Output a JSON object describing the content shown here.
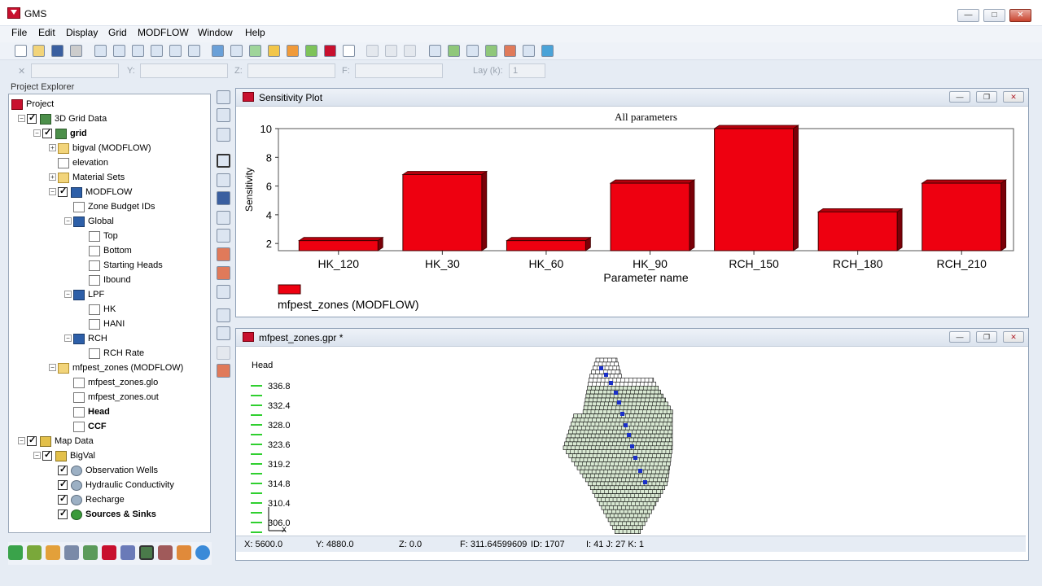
{
  "window": {
    "title": "GMS",
    "minimize": "—",
    "maximize": "□",
    "close": "✕"
  },
  "menu": [
    "File",
    "Edit",
    "Display",
    "Grid",
    "MODFLOW",
    "Window",
    "Help"
  ],
  "coordbar": {
    "x_label": "X:",
    "y_label": "Y:",
    "z_label": "Z:",
    "f_label": "F:",
    "lay_label": "Lay (k):",
    "lay_value": "1"
  },
  "project_explorer": {
    "title": "Project Explorer",
    "items": [
      {
        "label": "Project",
        "icon": "project-icon",
        "level": 0,
        "checked": null,
        "bold": false
      },
      {
        "label": "3D Grid Data",
        "icon": "grid-data-icon",
        "level": 1,
        "checked": true,
        "bold": false
      },
      {
        "label": "grid",
        "icon": "grid-icon",
        "level": 2,
        "checked": true,
        "bold": true
      },
      {
        "label": "bigval (MODFLOW)",
        "icon": "folder-icon",
        "level": 3,
        "checked": null,
        "bold": false
      },
      {
        "label": "elevation",
        "icon": "dataset-icon",
        "level": 3,
        "checked": null,
        "bold": false
      },
      {
        "label": "Material Sets",
        "icon": "folder-icon",
        "level": 3,
        "checked": null,
        "bold": false
      },
      {
        "label": "MODFLOW",
        "icon": "modflow-icon",
        "level": 3,
        "checked": true,
        "bold": false
      },
      {
        "label": "Zone Budget IDs",
        "icon": "dataset-icon",
        "level": 4,
        "checked": null,
        "bold": false
      },
      {
        "label": "Global",
        "icon": "package-icon",
        "level": 4,
        "checked": null,
        "bold": false
      },
      {
        "label": "Top",
        "icon": "dataset-icon",
        "level": 5,
        "checked": null,
        "bold": false
      },
      {
        "label": "Bottom",
        "icon": "dataset-icon",
        "level": 5,
        "checked": null,
        "bold": false
      },
      {
        "label": "Starting Heads",
        "icon": "dataset-icon",
        "level": 5,
        "checked": null,
        "bold": false
      },
      {
        "label": "Ibound",
        "icon": "dataset-icon",
        "level": 5,
        "checked": null,
        "bold": false
      },
      {
        "label": "LPF",
        "icon": "package-icon",
        "level": 4,
        "checked": null,
        "bold": false
      },
      {
        "label": "HK",
        "icon": "dataset-icon",
        "level": 5,
        "checked": null,
        "bold": false
      },
      {
        "label": "HANI",
        "icon": "dataset-icon",
        "level": 5,
        "checked": null,
        "bold": false
      },
      {
        "label": "RCH",
        "icon": "package-icon",
        "level": 4,
        "checked": null,
        "bold": false
      },
      {
        "label": "RCH Rate",
        "icon": "dataset-icon",
        "level": 5,
        "checked": null,
        "bold": false
      },
      {
        "label": "mfpest_zones (MODFLOW)",
        "icon": "folder-icon",
        "level": 3,
        "checked": null,
        "bold": false
      },
      {
        "label": "mfpest_zones.glo",
        "icon": "file-icon",
        "level": 4,
        "checked": null,
        "bold": false
      },
      {
        "label": "mfpest_zones.out",
        "icon": "file-icon",
        "level": 4,
        "checked": null,
        "bold": false
      },
      {
        "label": "Head",
        "icon": "dataset-icon",
        "level": 4,
        "checked": null,
        "bold": true
      },
      {
        "label": "CCF",
        "icon": "dataset-icon",
        "level": 4,
        "checked": null,
        "bold": true
      },
      {
        "label": "Map Data",
        "icon": "map-data-icon",
        "level": 1,
        "checked": true,
        "bold": false
      },
      {
        "label": "BigVal",
        "icon": "conceptual-model-icon",
        "level": 2,
        "checked": true,
        "bold": false
      },
      {
        "label": "Observation Wells",
        "icon": "coverage-icon",
        "level": 3,
        "checked": true,
        "bold": false
      },
      {
        "label": "Hydraulic Conductivity",
        "icon": "coverage-icon",
        "level": 3,
        "checked": true,
        "bold": false
      },
      {
        "label": "Recharge",
        "icon": "coverage-icon",
        "level": 3,
        "checked": true,
        "bold": false
      },
      {
        "label": "Sources & Sinks",
        "icon": "coverage-active-icon",
        "level": 3,
        "checked": true,
        "bold": true
      }
    ]
  },
  "sensitivity_window": {
    "title": "Sensitivity Plot"
  },
  "chart_data": {
    "type": "bar",
    "title": "All parameters",
    "xlabel": "Parameter name",
    "ylabel": "Sensitivity",
    "categories": [
      "HK_120",
      "HK_30",
      "HK_60",
      "HK_90",
      "RCH_150",
      "RCH_180",
      "RCH_210"
    ],
    "values": [
      2.2,
      6.8,
      2.2,
      6.2,
      10.0,
      4.2,
      6.2
    ],
    "ylim": [
      1.5,
      10
    ],
    "yticks": [
      "2",
      "4",
      "6",
      "8",
      "10"
    ],
    "legend": "mfpest_zones (MODFLOW)",
    "bar_color": "#ee0010"
  },
  "grid_window": {
    "title": "mfpest_zones.gpr *",
    "contour_legend_title": "Head",
    "contour_values": [
      "336.8",
      "332.4",
      "328.0",
      "323.6",
      "319.2",
      "314.8",
      "310.4",
      "306.0"
    ],
    "status": {
      "x": "X: 5600.0",
      "y": "Y: 4880.0",
      "z": "Z: 0.0",
      "f": "F: 311.64599609",
      "id": "ID: 1707",
      "ijk": "I: 41  J: 27  K: 1"
    }
  }
}
